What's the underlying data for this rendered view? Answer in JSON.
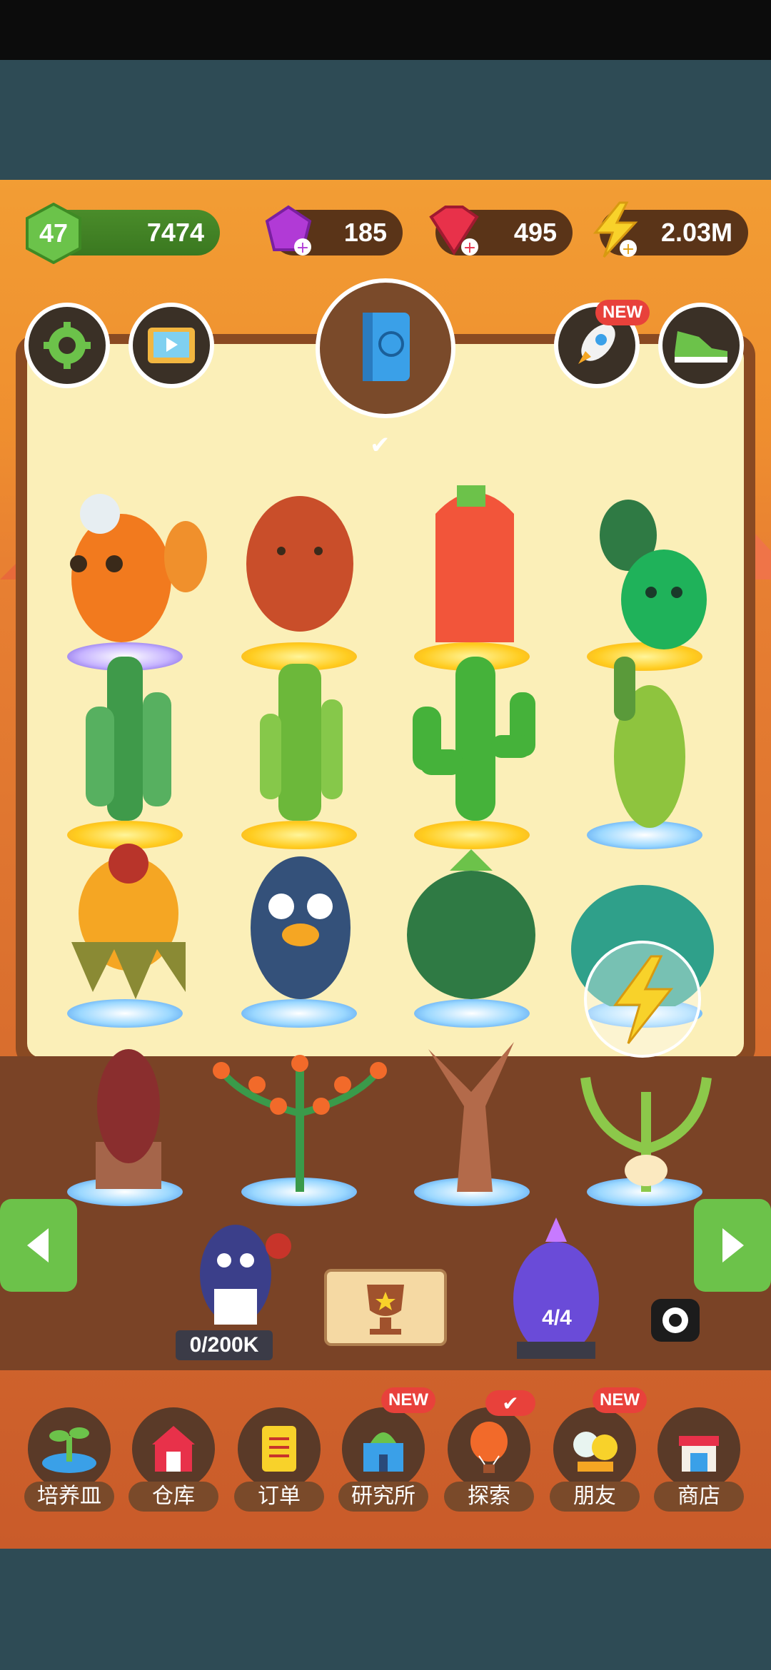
{
  "stats": {
    "level": "47",
    "coins": "7474",
    "gems": "185",
    "rubies": "495",
    "energy": "2.03M"
  },
  "badges": {
    "rocket_new": "NEW",
    "lab_new": "NEW",
    "friends_new": "NEW"
  },
  "counters": {
    "maid_progress": "0/200K",
    "crystal_progress": "4/4"
  },
  "nav": {
    "items": [
      {
        "label": "培养皿",
        "icon": "sprout-icon"
      },
      {
        "label": "仓库",
        "icon": "barn-icon"
      },
      {
        "label": "订单",
        "icon": "scroll-icon"
      },
      {
        "label": "研究所",
        "icon": "lab-icon"
      },
      {
        "label": "探索",
        "icon": "balloon-icon"
      },
      {
        "label": "朋友",
        "icon": "friends-icon"
      },
      {
        "label": "商店",
        "icon": "shop-icon"
      }
    ]
  },
  "colors": {
    "accent_green": "#6cc24a",
    "badge_red": "#e8413b",
    "board_cream": "#fbefb8"
  }
}
